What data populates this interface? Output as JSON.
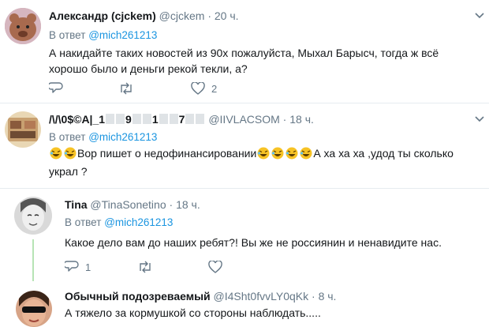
{
  "tweets": [
    {
      "name": "Александр (cjckem)",
      "handle": "@cjckem",
      "dot": "·",
      "time": "20 ч.",
      "reply_prefix": "В ответ",
      "reply_to": "@mich261213",
      "text": "А накидайте таких новостей из 90х пожалуйста, Мыхал Барысч, тогда ж всё хорошо было и деньги рекой текли, а?",
      "likes": "2"
    },
    {
      "name_parts": [
        "/\\/\\0$©A|_1",
        "9",
        "1",
        "7"
      ],
      "handle": "@IIVLACSOM",
      "dot": "·",
      "time": "18 ч.",
      "reply_prefix": "В ответ",
      "reply_to": "@mich261213",
      "text_a": "Вор пишет о недофинансировании",
      "text_b": "А ха ха ха ,удод ты сколько украл ?"
    },
    {
      "name": "Tina",
      "handle": "@TinaSonetino",
      "dot": "·",
      "time": "18 ч.",
      "reply_prefix": "В ответ",
      "reply_to": "@mich261213",
      "text": "Какое дело вам до наших ребят?! Вы же не россиянин и ненавидите нас.",
      "replies": "1"
    },
    {
      "name": "Обычный подозреваемый",
      "handle": "@I4Sht0fvvLY0qKk",
      "dot": "·",
      "time": "8 ч.",
      "text": "А тяжело за кормушкой со стороны наблюдать....."
    }
  ],
  "colors": {
    "link": "#1b95e0",
    "muted": "#657786",
    "thread": "#b7e4b5",
    "divider": "#e6ecf0"
  },
  "icons": [
    "reply-icon",
    "retweet-icon",
    "like-icon",
    "chevron-down-icon",
    "laughing-emoji-icon"
  ]
}
